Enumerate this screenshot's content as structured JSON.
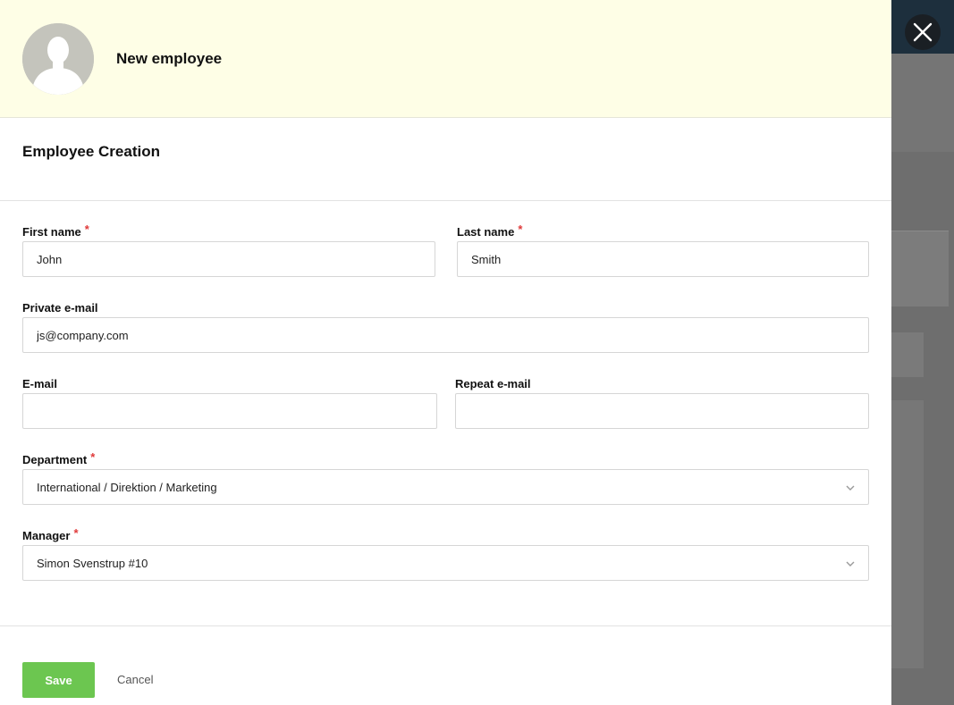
{
  "header": {
    "title": "New employee"
  },
  "section": {
    "title": "Employee Creation"
  },
  "form": {
    "first_name": {
      "label": "First name",
      "required_mark": "*",
      "value": "John"
    },
    "last_name": {
      "label": "Last name",
      "required_mark": "*",
      "value": "Smith"
    },
    "private_email": {
      "label": "Private e-mail",
      "value": "js@company.com"
    },
    "email": {
      "label": "E-mail",
      "value": ""
    },
    "repeat_email": {
      "label": "Repeat e-mail",
      "value": ""
    },
    "department": {
      "label": "Department",
      "required_mark": "*",
      "value": "International / Direktion / Marketing"
    },
    "manager": {
      "label": "Manager",
      "required_mark": "*",
      "value": "Simon Svenstrup #10"
    }
  },
  "actions": {
    "save_label": "Save",
    "cancel_label": "Cancel"
  },
  "colors": {
    "header_bg": "#fefee6",
    "save_green": "#6cc650",
    "required_red": "#e03a3a"
  },
  "icons": {
    "close": "close-icon",
    "avatar": "user-silhouette-icon",
    "chevron": "chevron-down-icon"
  }
}
